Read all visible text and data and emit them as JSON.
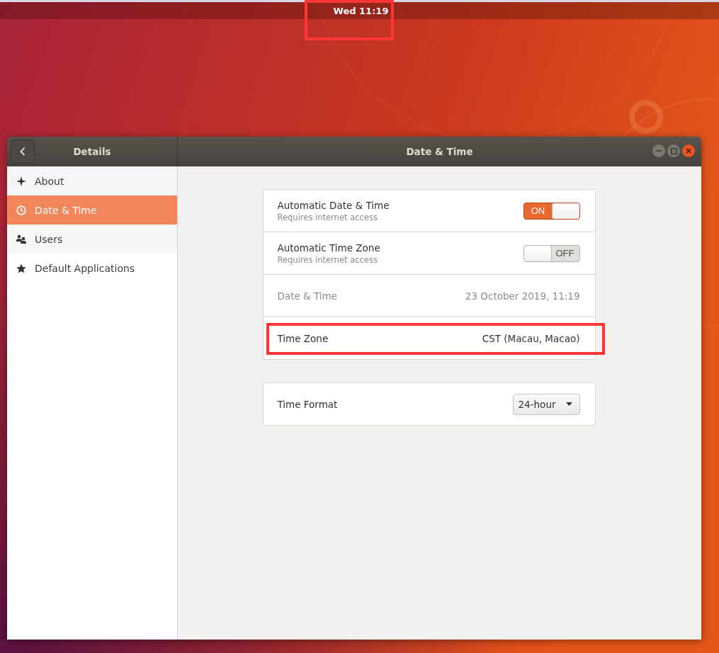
{
  "top_bar": {
    "clock": "Wed 11:19",
    "highlighted": true
  },
  "window": {
    "sidebar_title": "Details",
    "title": "Date & Time"
  },
  "sidebar": {
    "items": [
      {
        "label": "About",
        "kind": "about",
        "selected": false
      },
      {
        "label": "Date & Time",
        "kind": "datetime",
        "selected": true
      },
      {
        "label": "Users",
        "kind": "users",
        "selected": false
      },
      {
        "label": "Default Applications",
        "kind": "defaults",
        "selected": false
      }
    ]
  },
  "panels": [
    {
      "rows": [
        {
          "kind": "switch",
          "label": "Automatic Date & Time",
          "subtitle": "Requires internet access",
          "on": true,
          "switch_text": "ON"
        },
        {
          "kind": "switch",
          "label": "Automatic Time Zone",
          "subtitle": "Requires internet access",
          "on": false,
          "switch_text": "OFF"
        },
        {
          "kind": "value",
          "label": "Date & Time",
          "value": "23 October 2019, 11:19",
          "disabled": true
        },
        {
          "kind": "value",
          "label": "Time Zone",
          "value": "CST (Macau, Macao)",
          "disabled": false,
          "highlighted": true
        }
      ]
    },
    {
      "rows": [
        {
          "kind": "dropdown",
          "label": "Time Format",
          "value": "24-hour"
        }
      ]
    }
  ]
}
